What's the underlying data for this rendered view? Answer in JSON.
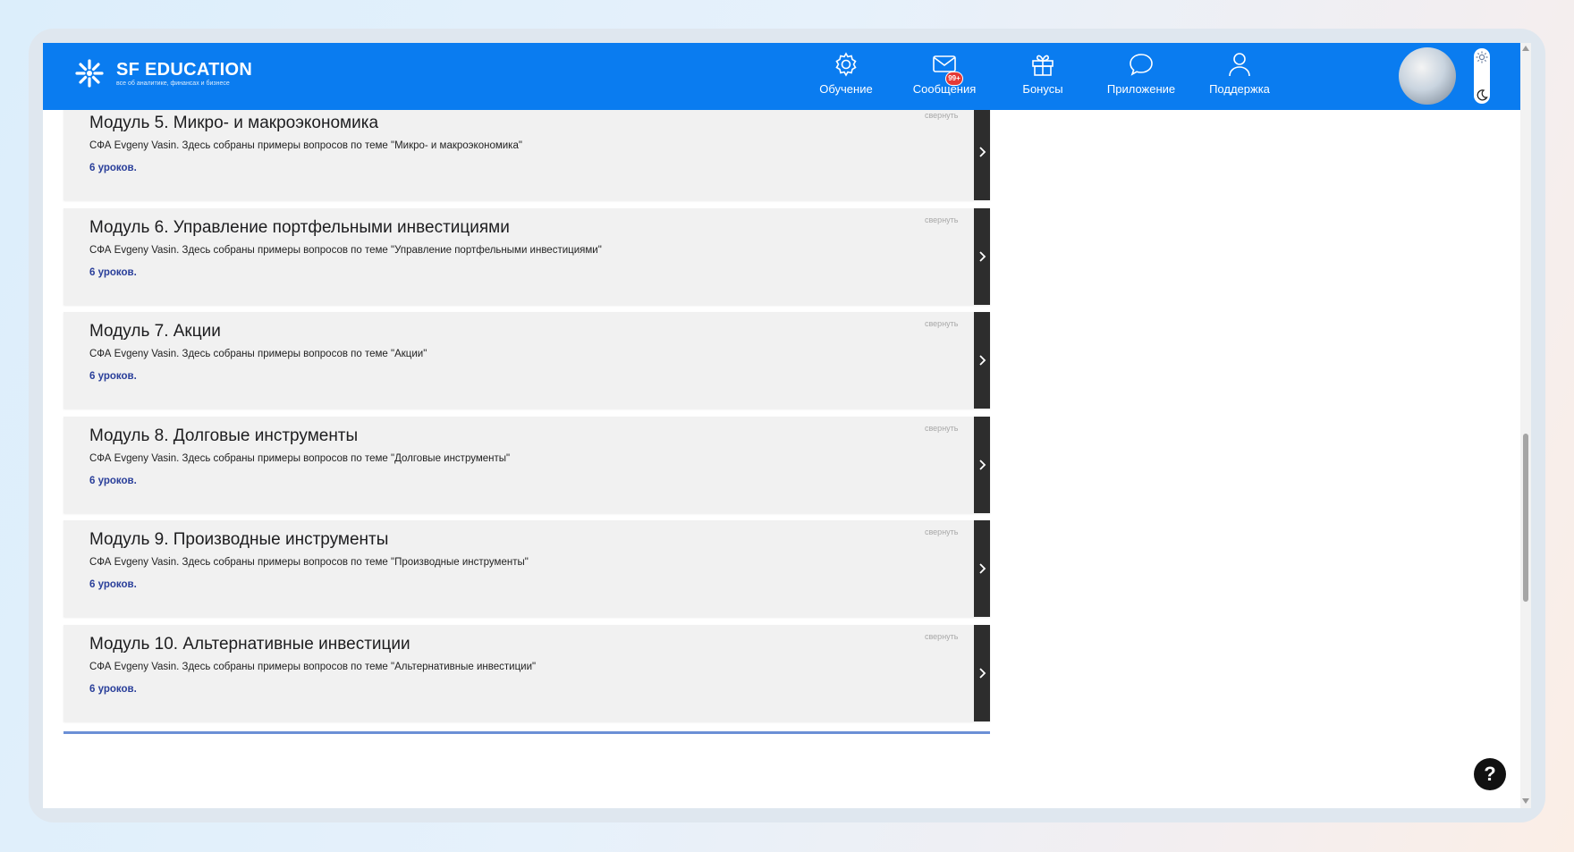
{
  "header": {
    "logo_title": "SF EDUCATION",
    "logo_tagline": "все об аналитике, финансах и бизнесе",
    "nav": [
      {
        "label": "Обучение",
        "icon": "gear-icon"
      },
      {
        "label": "Сообщения",
        "icon": "envelope-icon",
        "badge": "99+"
      },
      {
        "label": "Бонусы",
        "icon": "gift-icon"
      },
      {
        "label": "Приложение",
        "icon": "chat-bubble-icon"
      },
      {
        "label": "Поддержка",
        "icon": "user-icon"
      }
    ],
    "accent_color": "#0a7cf0"
  },
  "modules": [
    {
      "title": "Модуль 5. Микро- и макроэкономика",
      "description": "СФА Evgeny Vasin. Здесь собраны примеры вопросов по теме \"Микро- и макроэкономика\"",
      "lessons": "6 уроков.",
      "collapse_label": "свернуть"
    },
    {
      "title": "Модуль 6. Управление портфельными инвестициями",
      "description": "СФА Evgeny Vasin. Здесь собраны примеры вопросов по теме \"Управление портфельными инвестициями\"",
      "lessons": "6 уроков.",
      "collapse_label": "свернуть"
    },
    {
      "title": "Модуль 7. Акции",
      "description": "СФА Evgeny Vasin. Здесь собраны примеры вопросов по теме \"Акции\"",
      "lessons": "6 уроков.",
      "collapse_label": "свернуть"
    },
    {
      "title": "Модуль 8. Долговые инструменты",
      "description": "СФА Evgeny Vasin. Здесь собраны примеры вопросов по теме \"Долговые инструменты\"",
      "lessons": "6 уроков.",
      "collapse_label": "свернуть"
    },
    {
      "title": "Модуль 9. Производные инструменты",
      "description": "СФА Evgeny Vasin. Здесь собраны примеры вопросов по теме \"Производные инструменты\"",
      "lessons": "6 уроков.",
      "collapse_label": "свернуть"
    },
    {
      "title": "Модуль 10. Альтернативные инвестиции",
      "description": "СФА Evgeny Vasin. Здесь собраны примеры вопросов по теме \"Альтернативные инвестиции\"",
      "lessons": "6 уроков.",
      "collapse_label": "свернуть"
    }
  ],
  "help_button": {
    "label": "?"
  }
}
